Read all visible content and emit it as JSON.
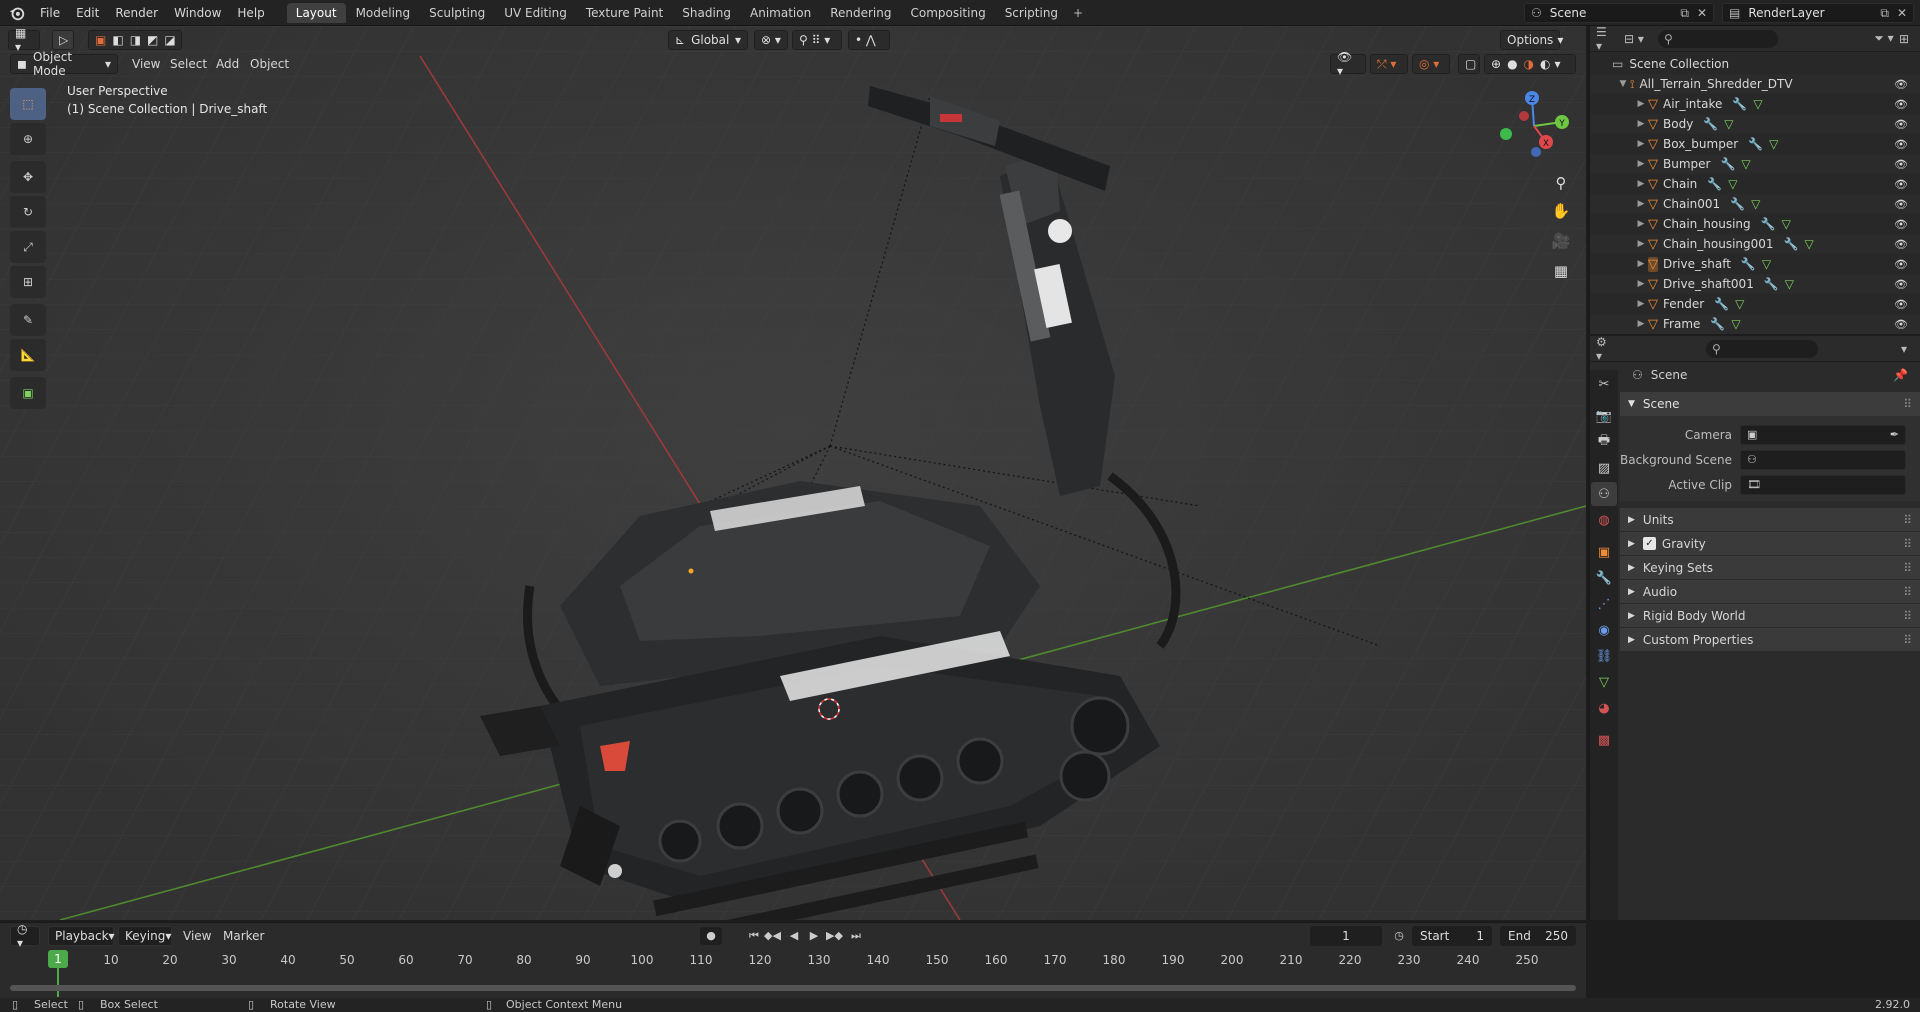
{
  "topbar": {
    "menus": [
      "File",
      "Edit",
      "Render",
      "Window",
      "Help"
    ],
    "workspaces": [
      "Layout",
      "Modeling",
      "Sculpting",
      "UV Editing",
      "Texture Paint",
      "Shading",
      "Animation",
      "Rendering",
      "Compositing",
      "Scripting"
    ],
    "active_workspace": "Layout",
    "add_tab": "+",
    "scene_name": "Scene",
    "view_layer": "RenderLayer"
  },
  "viewport": {
    "mode": "Object Mode",
    "menus": [
      "View",
      "Select",
      "Add",
      "Object"
    ],
    "orientation": "Global",
    "options_label": "Options",
    "info_line1": "User Perspective",
    "info_line2": "(1) Scene Collection | Drive_shaft",
    "gizmo": {
      "x": "X",
      "y": "Y",
      "z": "Z"
    }
  },
  "outliner": {
    "root": "Scene Collection",
    "collection": "All_Terrain_Shredder_DTV",
    "items": [
      "Air_intake",
      "Body",
      "Box_bumper",
      "Bumper",
      "Chain",
      "Chain001",
      "Chain_housing",
      "Chain_housing001",
      "Drive_shaft",
      "Drive_shaft001",
      "Fender",
      "Frame"
    ]
  },
  "properties": {
    "context": "Scene",
    "panel_title": "Scene",
    "fields": [
      {
        "label": "Camera"
      },
      {
        "label": "Background Scene"
      },
      {
        "label": "Active Clip"
      }
    ],
    "subpanels": [
      "Units",
      "Gravity",
      "Keying Sets",
      "Audio",
      "Rigid Body World",
      "Custom Properties"
    ],
    "gravity_checked": true
  },
  "timeline": {
    "menus": [
      "Playback",
      "Keying",
      "View",
      "Marker"
    ],
    "current_frame": "1",
    "start_label": "Start",
    "start_value": "1",
    "end_label": "End",
    "end_value": "250",
    "ruler": [
      "1",
      "10",
      "20",
      "30",
      "40",
      "50",
      "60",
      "70",
      "80",
      "90",
      "100",
      "110",
      "120",
      "130",
      "140",
      "150",
      "160",
      "170",
      "180",
      "190",
      "200",
      "210",
      "220",
      "230",
      "240",
      "250"
    ]
  },
  "statusbar": {
    "select": "Select",
    "box_select": "Box Select",
    "rotate_view": "Rotate View",
    "context_menu": "Object Context Menu",
    "version": "2.92.0"
  },
  "colors": {
    "accent_blue": "#4d6185",
    "frame_green": "#4daa4b",
    "object_orange": "#f08c33",
    "axis_x": "#e0474c",
    "axis_y": "#6ec642",
    "axis_z": "#4c86e6"
  }
}
